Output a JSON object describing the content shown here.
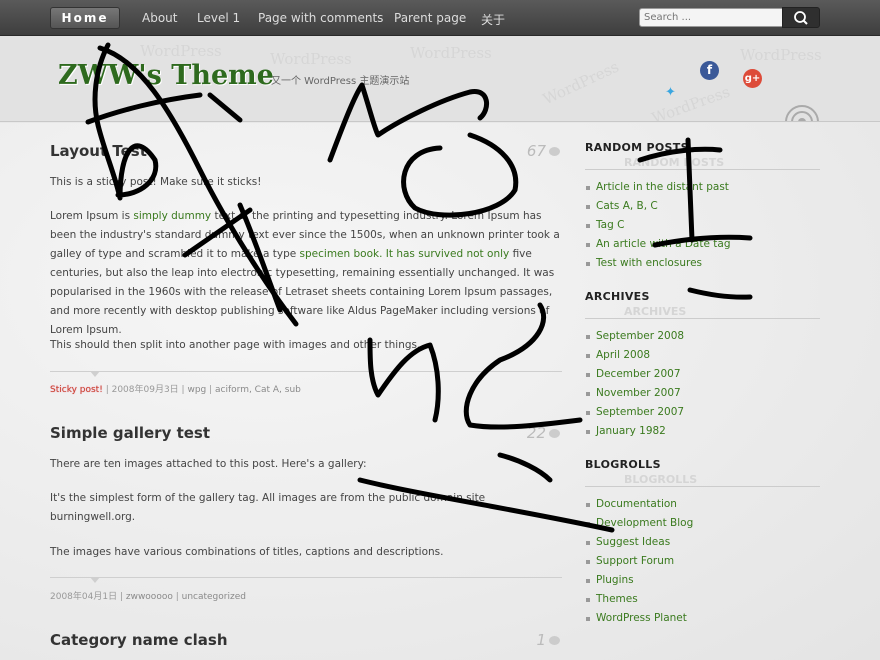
{
  "nav": {
    "home": "Home",
    "links": [
      "About",
      "Level 1",
      "Page with comments",
      "Parent page",
      "关于"
    ],
    "search_placeholder": "Search ..."
  },
  "header": {
    "site_title": "ZWW's Theme",
    "tagline": "又一个 WordPress 主题演示站",
    "watermark": "WordPress"
  },
  "posts": [
    {
      "title": "Layout Test",
      "comments": "67",
      "p1": "This is a sticky post! Make sure it sticks!",
      "p2_a": "Lorem Ipsum is ",
      "p2_link1": "simply dummy",
      "p2_b": " text of the printing and typesetting industry. Lorem Ipsum has been the industry's standard dummy text ever since the 1500s, when an unknown printer took a galley of type and scrambled it to make a type ",
      "p2_link2": "specimen book. It has survived not only",
      "p2_c": " five centuries, but also the leap into electronic typesetting, remaining essentially unchanged. It was popularised in the 1960s with the release of Letraset sheets containing Lorem Ipsum passages, and more recently with desktop publishing software like Aldus PageMaker including versions of Lorem Ipsum.",
      "p3": "This should then split into another page with images and other things.",
      "meta_sticky": "Sticky post!",
      "meta_date": "2008年09月3日",
      "meta_author": "wpg",
      "meta_cats": "aciform, Cat A, sub"
    },
    {
      "title": "Simple gallery test",
      "comments": "22",
      "p1": "There are ten images attached to this post.  Here's a gallery:",
      "p2": "It's the simplest form of the gallery tag.  All images are from the public domain site burningwell.org.",
      "p3": "The images have various combinations of titles, captions and descriptions.",
      "meta_date": "2008年04月1日",
      "meta_author": "zwwooooo",
      "meta_cats": "uncategorized"
    },
    {
      "title": "Category name clash",
      "comments": "1"
    }
  ],
  "sidebar": {
    "random_title": "RANDOM POSTS",
    "random": [
      "Article in the distant past",
      "Cats A, B, C",
      "Tag C",
      "An article with a Date tag",
      "Test with enclosures"
    ],
    "archives_title": "ARCHIVES",
    "archives": [
      "September 2008",
      "April 2008",
      "December 2007",
      "November 2007",
      "September 2007",
      "January 1982"
    ],
    "blogrolls_title": "BLOGROLLS",
    "blogrolls": [
      "Documentation",
      "Development Blog",
      "Suggest Ideas",
      "Support Forum",
      "Plugins",
      "Themes",
      "WordPress Planet"
    ]
  },
  "colors": {
    "link": "#3a7a1e",
    "title_green": "#2e6a1e",
    "nav_bg": "#4a4a4a"
  }
}
